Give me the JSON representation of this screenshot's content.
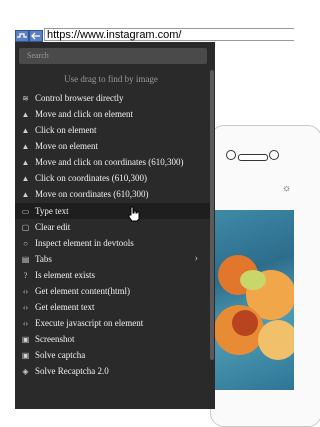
{
  "address_bar": {
    "url": "https://www.instagram.com/"
  },
  "menu": {
    "search_placeholder": "Search",
    "hint": "Use drag to find by image",
    "items": [
      {
        "label": "Control browser directly",
        "icon": "wifi-icon"
      },
      {
        "label": "Move and click on element",
        "icon": "cursor-icon"
      },
      {
        "label": "Click on element",
        "icon": "cursor-icon"
      },
      {
        "label": "Move on element",
        "icon": "cursor-icon"
      },
      {
        "label": "Move and click on coordinates (610,300)",
        "icon": "cursor-icon"
      },
      {
        "label": "Click on coordinates (610,300)",
        "icon": "cursor-icon"
      },
      {
        "label": "Move on coordinates (610,300)",
        "icon": "cursor-icon"
      },
      {
        "label": "Type text",
        "icon": "keyboard-icon"
      },
      {
        "label": "Clear edit",
        "icon": "eraser-icon"
      },
      {
        "label": "Inspect element in devtools",
        "icon": "search-icon"
      },
      {
        "label": "Tabs",
        "icon": "folder-icon"
      },
      {
        "label": "Is element exists",
        "icon": "question-icon"
      },
      {
        "label": "Get element content(html)",
        "icon": "code-icon"
      },
      {
        "label": "Get element text",
        "icon": "code-icon"
      },
      {
        "label": "Execute javascript on element",
        "icon": "code-icon"
      },
      {
        "label": "Screenshot",
        "icon": "image-icon"
      },
      {
        "label": "Solve captcha",
        "icon": "image-icon"
      },
      {
        "label": "Solve Recaptcha 2.0",
        "icon": "shield-icon"
      }
    ]
  }
}
